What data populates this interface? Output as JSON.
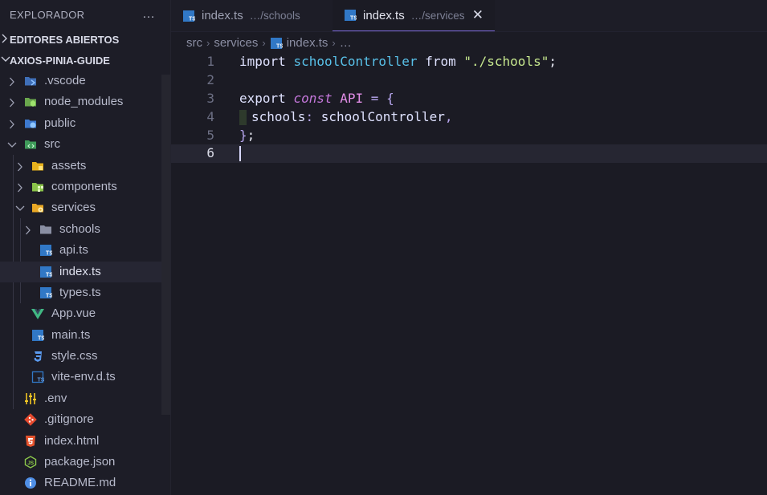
{
  "sidebar": {
    "title": "EXPLORADOR",
    "more_icon": "…",
    "sections": [
      {
        "label": "EDITORES ABIERTOS"
      },
      {
        "label": "AXIOS-PINIA-GUIDE"
      }
    ],
    "tree": [
      {
        "label": ".vscode",
        "icon": "vscode-folder-icon"
      },
      {
        "label": "node_modules",
        "icon": "node-folder-icon"
      },
      {
        "label": "public",
        "icon": "public-folder-icon"
      },
      {
        "label": "src",
        "icon": "src-folder-icon"
      },
      {
        "label": "assets",
        "icon": "assets-folder-icon"
      },
      {
        "label": "components",
        "icon": "components-folder-icon"
      },
      {
        "label": "services",
        "icon": "services-folder-icon"
      },
      {
        "label": "schools",
        "icon": "folder-icon"
      },
      {
        "label": "api.ts",
        "icon": "typescript-icon"
      },
      {
        "label": "index.ts",
        "icon": "typescript-icon"
      },
      {
        "label": "types.ts",
        "icon": "typescript-icon"
      },
      {
        "label": "App.vue",
        "icon": "vue-icon"
      },
      {
        "label": "main.ts",
        "icon": "typescript-icon"
      },
      {
        "label": "style.css",
        "icon": "css-icon"
      },
      {
        "label": "vite-env.d.ts",
        "icon": "typescript-def-icon"
      },
      {
        "label": ".env",
        "icon": "env-icon"
      },
      {
        "label": ".gitignore",
        "icon": "git-icon"
      },
      {
        "label": "index.html",
        "icon": "html-icon"
      },
      {
        "label": "package.json",
        "icon": "node-json-icon"
      },
      {
        "label": "README.md",
        "icon": "info-icon"
      }
    ]
  },
  "tabs": [
    {
      "name": "index.ts",
      "path": "…/schools",
      "active": false
    },
    {
      "name": "index.ts",
      "path": "…/services",
      "active": true,
      "close": "✕"
    }
  ],
  "breadcrumb": {
    "items": [
      "src",
      "services",
      "index.ts",
      "…"
    ]
  },
  "editor": {
    "line_numbers": [
      "1",
      "2",
      "3",
      "4",
      "5",
      "6"
    ],
    "code": {
      "l1_import": "import",
      "l1_name": "schoolController",
      "l1_from": "from",
      "l1_str": "\"./schools\"",
      "l1_semi": ";",
      "l3_export": "export",
      "l3_const": "const",
      "l3_api": "API",
      "l3_eq": "=",
      "l3_brace": "{",
      "l4_key": "schools",
      "l4_colon": ":",
      "l4_val": "schoolController",
      "l4_comma": ",",
      "l5_close": "}",
      "l5_semi": ";"
    }
  },
  "colors": {
    "background": "#1b1b24",
    "accent": "#7d6bd8",
    "ts_blue": "#3178c6",
    "string": "#c7e88f",
    "identifier": "#59c2ea"
  }
}
